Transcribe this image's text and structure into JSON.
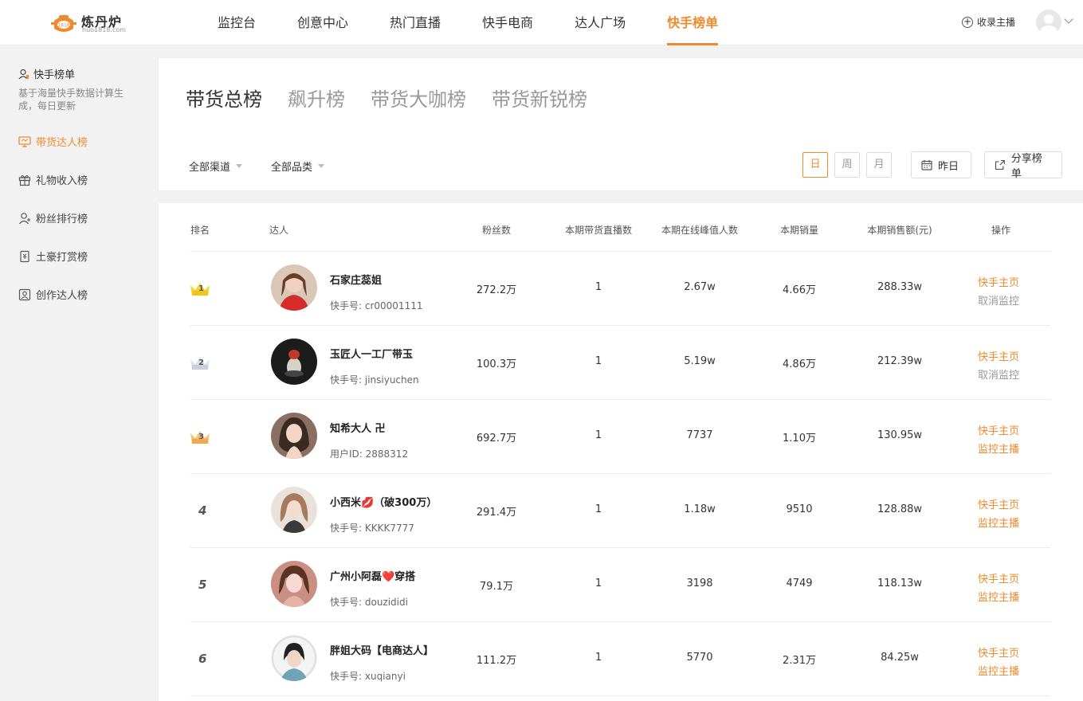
{
  "brand": {
    "name": "炼丹炉",
    "sub": "huo1818.com",
    "accent": "#f08a2c"
  },
  "nav": [
    "监控台",
    "创意中心",
    "热门直播",
    "快手电商",
    "达人广场",
    "快手榜单"
  ],
  "header_right": {
    "collect_label": "收录主播"
  },
  "sidebar": {
    "title": "快手榜单",
    "desc": "基于海量快手数据计算生成，每日更新",
    "items": [
      {
        "label": "带货达人榜",
        "icon": "monitor-icon"
      },
      {
        "label": "礼物收入榜",
        "icon": "gift-icon"
      },
      {
        "label": "粉丝排行榜",
        "icon": "user-icon"
      },
      {
        "label": "土豪打赏榜",
        "icon": "receipt-icon"
      },
      {
        "label": "创作达人榜",
        "icon": "profile-card-icon"
      }
    ]
  },
  "tabs": [
    "带货总榜",
    "飙升榜",
    "带货大咖榜",
    "带货新锐榜"
  ],
  "filters": {
    "channel": "全部渠道",
    "category": "全部品类"
  },
  "periods": [
    "日",
    "周",
    "月"
  ],
  "date_button": "昨日",
  "share_button": "分享榜单",
  "table": {
    "headers": [
      "排名",
      "达人",
      "粉丝数",
      "本期带货直播数",
      "本期在线峰值人数",
      "本期销量",
      "本期销售额(元)",
      "操作"
    ],
    "rows": [
      {
        "rank": "1",
        "name": "石家庄蕊姐",
        "uid": "快手号: cr00001111",
        "fans": "272.2万",
        "lives": "1",
        "peak": "2.67w",
        "sales": "4.66万",
        "amount": "288.33w",
        "op1": "快手主页",
        "op2": "取消监控"
      },
      {
        "rank": "2",
        "name": "玉匠人一工厂带玉",
        "uid": "快手号: jinsiyuchen",
        "fans": "100.3万",
        "lives": "1",
        "peak": "5.19w",
        "sales": "4.86万",
        "amount": "212.39w",
        "op1": "快手主页",
        "op2": "取消监控"
      },
      {
        "rank": "3",
        "name": "知希大人 卍",
        "uid": "用户ID: 2888312",
        "fans": "692.7万",
        "lives": "1",
        "peak": "7737",
        "sales": "1.10万",
        "amount": "130.95w",
        "op1": "快手主页",
        "op2": "监控主播"
      },
      {
        "rank": "4",
        "name": "小西米💋（破300万）",
        "uid": "快手号: KKKK7777",
        "fans": "291.4万",
        "lives": "1",
        "peak": "1.18w",
        "sales": "9510",
        "amount": "128.88w",
        "op1": "快手主页",
        "op2": "监控主播"
      },
      {
        "rank": "5",
        "name": "广州小阿磊❤️穿搭",
        "uid": "快手号: douzididi",
        "fans": "79.1万",
        "lives": "1",
        "peak": "3198",
        "sales": "4749",
        "amount": "118.13w",
        "op1": "快手主页",
        "op2": "监控主播"
      },
      {
        "rank": "6",
        "name": "胖姐大码【电商达人】",
        "uid": "快手号: xuqianyi",
        "fans": "111.2万",
        "lives": "1",
        "peak": "5770",
        "sales": "2.31万",
        "amount": "84.25w",
        "op1": "快手主页",
        "op2": "监控主播"
      }
    ]
  }
}
